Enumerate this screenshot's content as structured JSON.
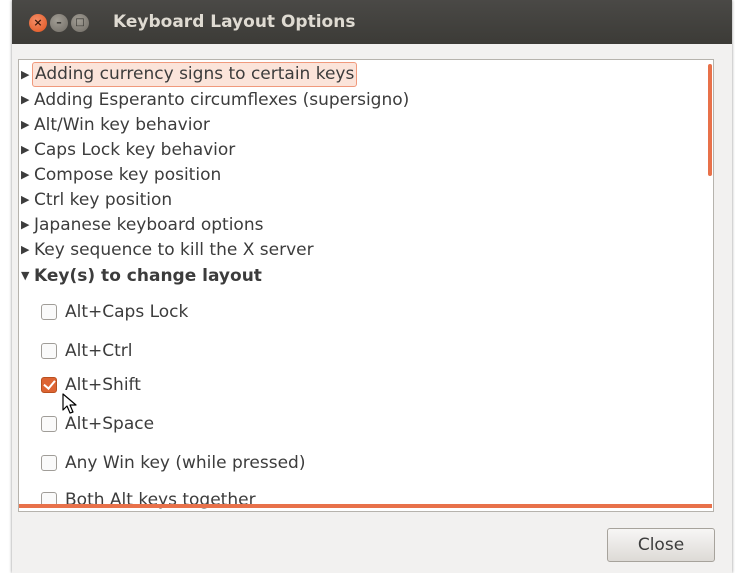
{
  "window": {
    "title": "Keyboard Layout Options",
    "buttons": {
      "close": "×",
      "minimize": "–",
      "maximize": "□"
    }
  },
  "tree": {
    "collapsed_items": [
      "Adding currency signs to certain keys",
      "Adding Esperanto circumflexes (supersigno)",
      "Alt/Win key behavior",
      "Caps Lock key behavior",
      "Compose key position",
      "Ctrl key position",
      "Japanese keyboard options",
      "Key sequence to kill the X server"
    ],
    "expanded_group": "Key(s) to change layout",
    "options": [
      {
        "label": "Alt+Caps Lock",
        "checked": false
      },
      {
        "label": "Alt+Ctrl",
        "checked": false
      },
      {
        "label": "Alt+Shift",
        "checked": true
      },
      {
        "label": "Alt+Space",
        "checked": false
      },
      {
        "label": "Any Win key (while pressed)",
        "checked": false
      },
      {
        "label": "Both Alt keys together",
        "checked": false
      }
    ],
    "expander_collapsed": "▶",
    "expander_expanded": "▼"
  },
  "footer": {
    "close_label": "Close"
  },
  "colors": {
    "accent": "#dd6433",
    "scroll": "#e8714a",
    "titlebar": "#3c3b37"
  }
}
